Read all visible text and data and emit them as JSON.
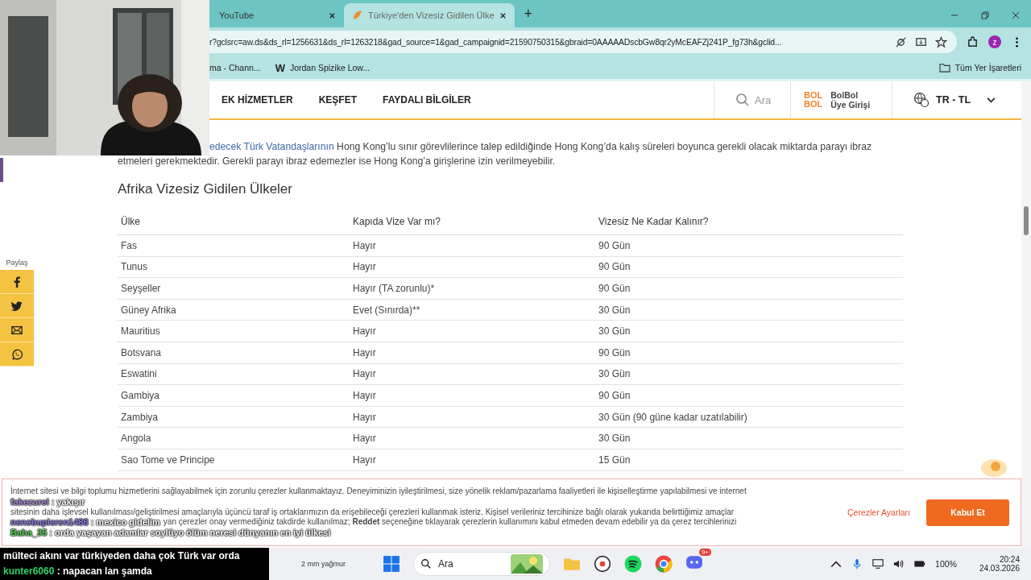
{
  "browser": {
    "tabs": [
      {
        "title": "YouTube",
        "selected": false
      },
      {
        "title": "Türkiye'den Vizesiz Gidilen Ülke",
        "selected": true
      }
    ],
    "new_tab": "+",
    "url": "r?gclsrc=aw.ds&ds_rl=1256631&ds_rl=1263218&gad_source=1&gad_campaignid=21590750315&gbraid=0AAAAADscbGw8qr2yMcEAFZj241P_fg73h&gclid...",
    "profile": "z",
    "bookmarks": [
      "ma - Chann...",
      "Jordan Spizike Low..."
    ],
    "bookmark_logo": "W",
    "all_bookmarks": "Tüm Yer İşaretleri"
  },
  "site": {
    "nav": [
      "EK HİZMETLER",
      "KEŞFET",
      "FAYDALI BİLGİLER"
    ],
    "search": {
      "placeholder": "Ara"
    },
    "logo_lines": [
      "BOL",
      "BOL"
    ],
    "member_lines": [
      "BolBol",
      "Üye Girişi"
    ],
    "currency": "TR - TL"
  },
  "article": {
    "link": "edecek Türk Vatandaşlarının",
    "line_1": " Hong Kong’lu sınır görevlilerince talep edildiğinde Hong Kong’da kalış süreleri boyunca gerekli olacak miktarda parayı ibraz",
    "line_2": "etmeleri gerekmektedir. Gerekli parayı ibraz edemezler ise Hong Kong’a girişlerine izin verilmeyebilir.",
    "heading": "Afrika Vizesiz Gidilen Ülkeler",
    "table": {
      "columns": [
        "Ülke",
        "Kapıda Vize Var mı?",
        "Vizesiz Ne Kadar Kalınır?"
      ],
      "rows": [
        [
          "Fas",
          "Hayır",
          "90 Gün"
        ],
        [
          "Tunus",
          "Hayır",
          "90 Gün"
        ],
        [
          "Seyşeller",
          "Hayır (TA zorunlu)*",
          "90 Gün"
        ],
        [
          "Güney Afrika",
          "Evet (Sınırda)**",
          "30 Gün"
        ],
        [
          "Mauritius",
          "Hayır",
          "30 Gün"
        ],
        [
          "Botsvana",
          "Hayır",
          "90 Gün"
        ],
        [
          "Eswatini",
          "Hayır",
          "30 Gün"
        ],
        [
          "Gambiya",
          "Hayır",
          "90 Gün"
        ],
        [
          "Zambiya",
          "Hayır",
          "30 Gün (90 güne kadar uzatılabilir)"
        ],
        [
          "Angola",
          "Hayır",
          "30 Gün"
        ],
        [
          "Sao Tome ve Principe",
          "Hayır",
          "15 Gün"
        ]
      ]
    }
  },
  "share": {
    "label": "Paylaş",
    "buttons": [
      {
        "kind": "facebook"
      },
      {
        "kind": "twitter"
      },
      {
        "kind": "mail"
      },
      {
        "kind": "whatsapp"
      }
    ]
  },
  "cookie_banner": {
    "line_1": "İnternet sitesi ve bilgi toplumu hizmetlerini sağlayabilmek için zorunlu çerezler kullanmaktayız. Deneyiminizin iyileştirilmesi, size yönelik reklam/pazarlama faaliyetleri ile kişiselleştirme yapılabilmesi ve internet",
    "line_2": "sitesinin daha işlevsel kullanılması/geliştirilmesi amaçlarıyla üçüncü taraf iş ortaklarımızın da erişebileceği çerezleri kullanmak isteriz. Kişisel verileriniz tercihinize bağlı olarak yukarıda belirttiğimiz amaçlar",
    "line_3": "yan çerezler onay vermediğiniz takdirde kullanılmaz; **Reddet** seçeneğine tıklayarak çerezlerin kullanımını kabul etmeden devam edebilir ya da çerez tercihlerinizi",
    "settings": "Çerezler Ayarları",
    "accept": "Kabul Et"
  },
  "chat": [
    {
      "user": "fakezurel",
      "message": " : yakışır",
      "color": "#a98bd6"
    },
    {
      "user": "nenebupleren1488",
      "message": " : mexico gidelim",
      "color": "#8c7ee0"
    },
    {
      "user": "Baha_35",
      "message": " : orda yaşayan adamlar soylüyo ölüm neresi dünyanın en iyi ülkesi",
      "color": "#5fd35f"
    },
    {
      "message": "mülteci akını var türkiyeden daha çok Türk var orda"
    },
    {
      "user": "kunter6060",
      "message": " : napacan lan şamda",
      "color": "#2fd46a"
    }
  ],
  "taskbar": {
    "weather": "2 mm yağmur",
    "search": "Ara",
    "discord_badge": "9+",
    "battery": "100%",
    "time": "20:24",
    "date": "24.03.2026"
  }
}
